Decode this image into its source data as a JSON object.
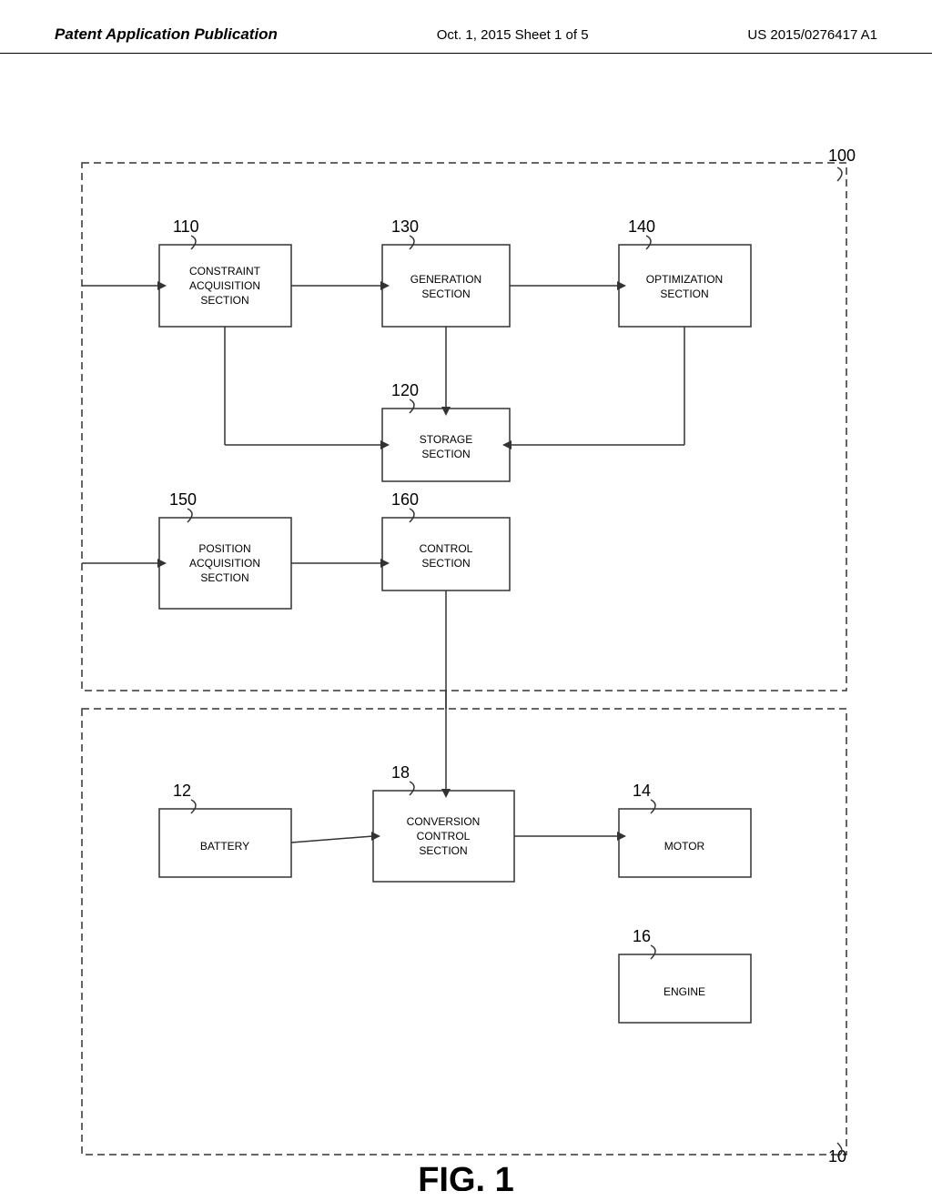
{
  "header": {
    "left": "Patent Application Publication",
    "center": "Oct. 1, 2015   Sheet 1 of 5",
    "right": "US 2015/0276417 A1"
  },
  "fig_label": "FIG. 1",
  "diagram": {
    "ref_100": "100",
    "ref_110": "110",
    "ref_120": "120",
    "ref_130": "130",
    "ref_140": "140",
    "ref_150": "150",
    "ref_160": "160",
    "ref_10": "10",
    "ref_12": "12",
    "ref_14": "14",
    "ref_16": "16",
    "ref_18": "18",
    "box_constraint": "CONSTRAINT\nACQUISITION\nSECTION",
    "box_generation": "GENERATION\nSECTION",
    "box_optimization": "OPTIMIZATION\nSECTION",
    "box_storage": "STORAGE\nSECTION",
    "box_position": "POSITION\nACQUISITION\nSECTION",
    "box_control": "CONTROL\nSECTION",
    "box_battery": "BATTERY",
    "box_conversion": "CONVERSION\nCONTROL\nSECTION",
    "box_motor": "MOTOR",
    "box_engine": "ENGINE"
  }
}
